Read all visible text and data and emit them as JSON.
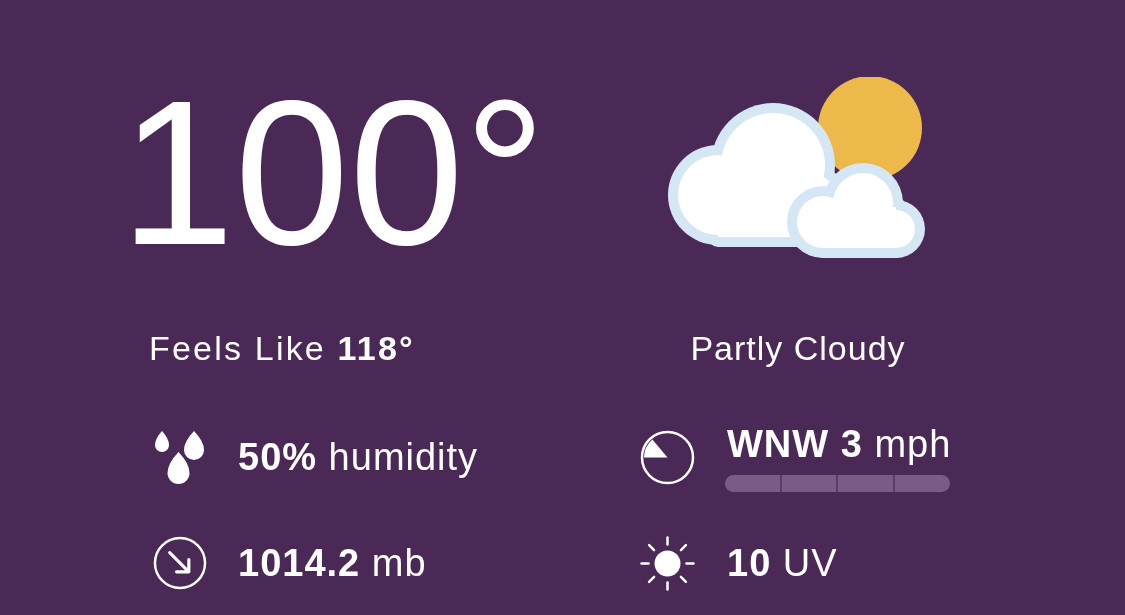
{
  "current": {
    "temperature": "100°",
    "feels_like": "Feels Like **118°**",
    "condition": "Partly Cloudy"
  },
  "stats": [
    {
      "kind": "humidity",
      "text": "**50%** humidity"
    },
    {
      "kind": "wind",
      "text": "**WNW 3** mph"
    },
    {
      "kind": "pressure",
      "text": "**1014.2** mb"
    },
    {
      "kind": "uv",
      "text": "**10** UV"
    }
  ]
}
